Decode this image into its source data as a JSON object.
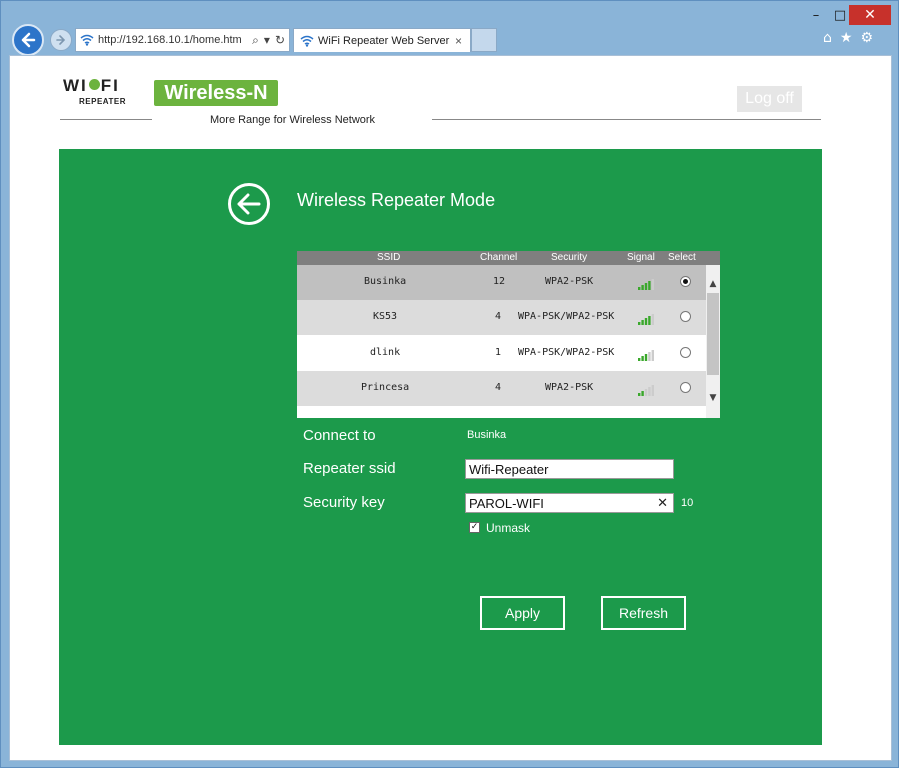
{
  "browser": {
    "address": "http://192.168.10.1/home.htm",
    "tab_title": "WiFi Repeater Web Server",
    "tab_close": "×",
    "search_glyph": "⌕",
    "dropdown_glyph": "▾",
    "refresh_glyph": "↻",
    "minimize_glyph": "–",
    "maximize_glyph": "□",
    "close_glyph": "✕",
    "home_glyph": "⌂",
    "favorites_glyph": "★",
    "settings_glyph": "⚙"
  },
  "header": {
    "logo_left": "WI",
    "logo_right": "FI",
    "logo_sub": "REPEATER",
    "badge": "Wireless-N",
    "tagline": "More Range for Wireless Network",
    "logoff": "Log off"
  },
  "main": {
    "title": "Wireless Repeater Mode",
    "table": {
      "headers": [
        "SSID",
        "Channel",
        "Security",
        "Signal",
        "Select"
      ],
      "rows": [
        {
          "ssid": "Businka",
          "channel": "12",
          "security": "WPA2-PSK",
          "signal": 4,
          "selected": true
        },
        {
          "ssid": "KS53",
          "channel": "4",
          "security": "WPA-PSK/WPA2-PSK",
          "signal": 4,
          "selected": false
        },
        {
          "ssid": "dlink",
          "channel": "1",
          "security": "WPA-PSK/WPA2-PSK",
          "signal": 3,
          "selected": false
        },
        {
          "ssid": "Princesa",
          "channel": "4",
          "security": "WPA2-PSK",
          "signal": 2,
          "selected": false
        }
      ]
    },
    "form": {
      "connect_to_label": "Connect to",
      "connect_to_value": "Businka",
      "repeater_ssid_label": "Repeater ssid",
      "repeater_ssid_value": "Wifi-Repeater",
      "security_key_label": "Security key",
      "security_key_value": "PAROL-WIFI",
      "clear_glyph": "✕",
      "key_length": "10",
      "unmask_label": "Unmask",
      "unmask_checked": true,
      "check_glyph": "✓"
    },
    "buttons": {
      "apply": "Apply",
      "refresh": "Refresh"
    }
  },
  "colors": {
    "panel": "#1c9a4b",
    "brand_green": "#6cb33e",
    "signal_on": "#3aa82c",
    "signal_off": "#cccccc"
  }
}
